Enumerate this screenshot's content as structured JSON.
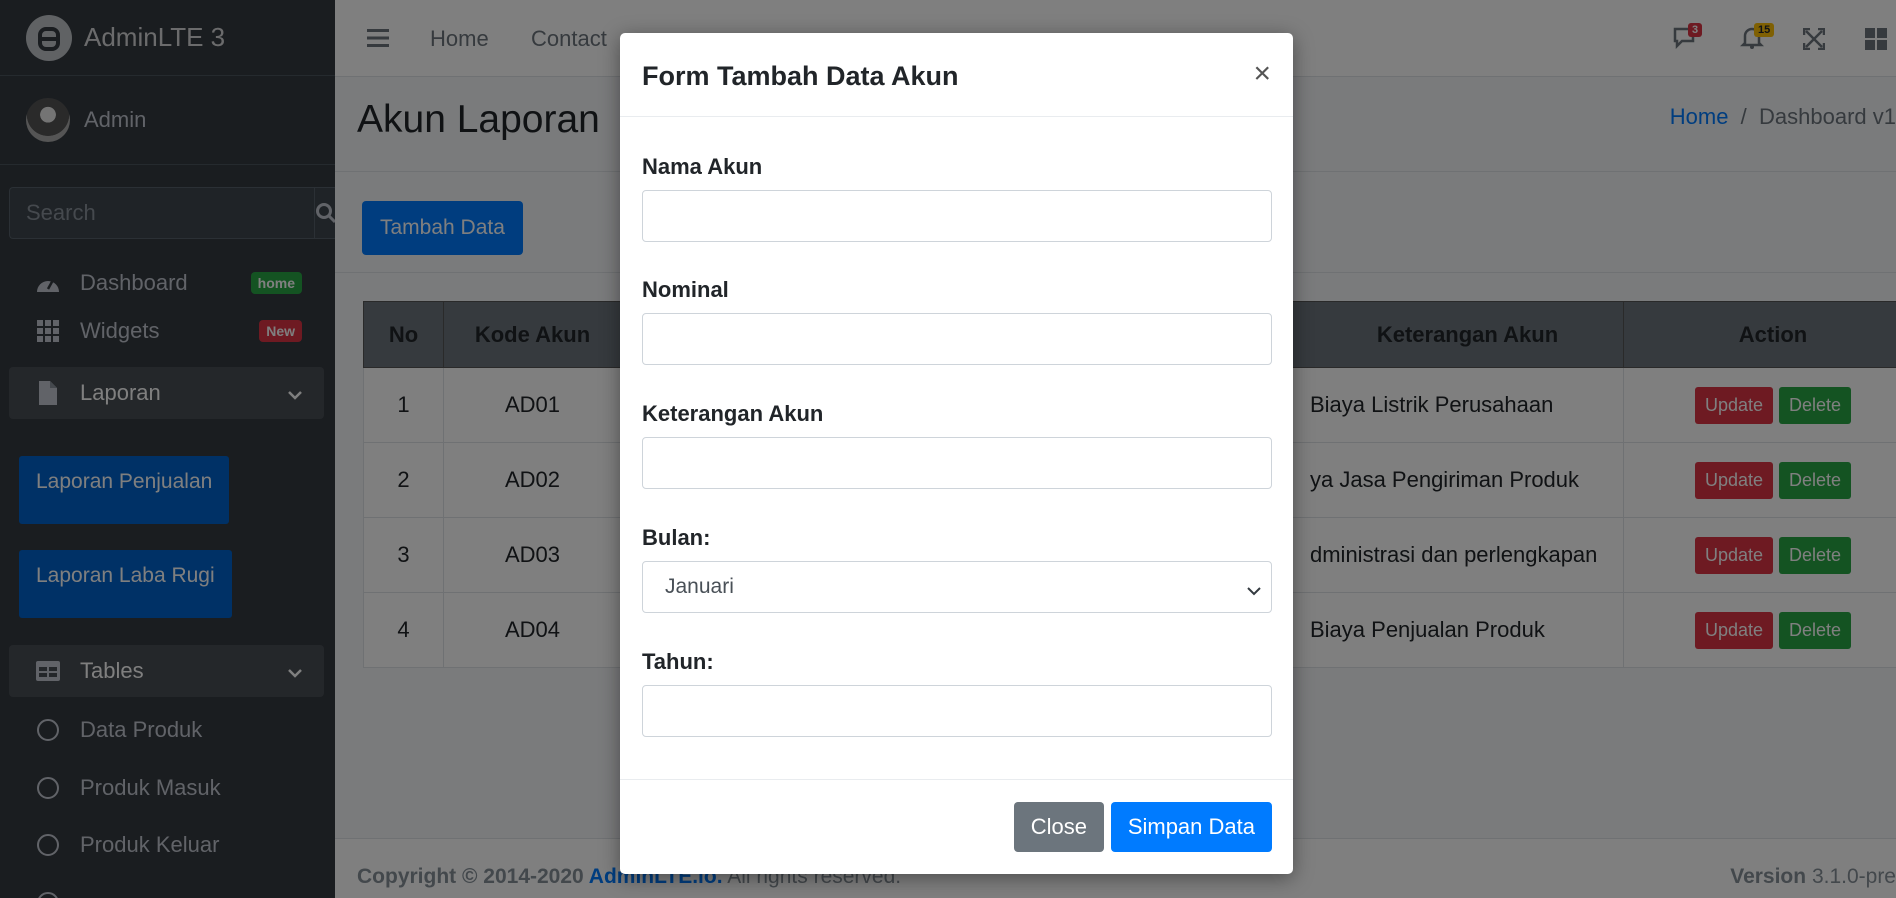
{
  "brand": {
    "name": "AdminLTE 3"
  },
  "user": {
    "name": "Admin"
  },
  "sidebar": {
    "search_placeholder": "Search",
    "items": [
      {
        "label": "Dashboard",
        "badge": "home"
      },
      {
        "label": "Widgets",
        "badge": "New"
      },
      {
        "label": "Laporan"
      },
      {
        "label": "Laporan Penjualan"
      },
      {
        "label": "Laporan Laba Rugi"
      },
      {
        "label": "Tables"
      },
      {
        "label": "Data Produk"
      },
      {
        "label": "Produk Masuk"
      },
      {
        "label": "Produk Keluar"
      }
    ]
  },
  "topnav": {
    "home": "Home",
    "contact": "Contact",
    "messages_count": "3",
    "notifications_count": "15"
  },
  "page": {
    "title": "Akun Laporan",
    "breadcrumb_home": "Home",
    "breadcrumb_current": "Dashboard v1",
    "add_button": "Tambah Data"
  },
  "table": {
    "headers": [
      "No",
      "Kode Akun",
      "Keterangan Akun",
      "Action"
    ],
    "rows": [
      {
        "no": "1",
        "kode": "AD01",
        "ket": "Biaya Listrik Perusahaan"
      },
      {
        "no": "2",
        "kode": "AD02",
        "ket": "ya Jasa Pengiriman Produk"
      },
      {
        "no": "3",
        "kode": "AD03",
        "ket": "dministrasi dan perlengkapan"
      },
      {
        "no": "4",
        "kode": "AD04",
        "ket": "Biaya Penjualan Produk"
      }
    ],
    "update_label": "Update",
    "delete_label": "Delete"
  },
  "footer": {
    "copyright": "Copyright © 2014-2020 ",
    "link": "AdminLTE.io.",
    "rights": " All rights reserved.",
    "version_label": "Version",
    "version_value": "3.1.0-pre"
  },
  "modal": {
    "title": "Form Tambah Data Akun",
    "close_x": "×",
    "fields": {
      "nama_akun_label": "Nama Akun",
      "nominal_label": "Nominal",
      "keterangan_label": "Keterangan Akun",
      "bulan_label": "Bulan:",
      "bulan_value": "Januari",
      "tahun_label": "Tahun:"
    },
    "close_button": "Close",
    "save_button": "Simpan Data"
  },
  "colors": {
    "sidebar_bg": "#343a40",
    "primary": "#007bff",
    "danger": "#dc3545",
    "success": "#28a745",
    "secondary": "#6c757d"
  }
}
